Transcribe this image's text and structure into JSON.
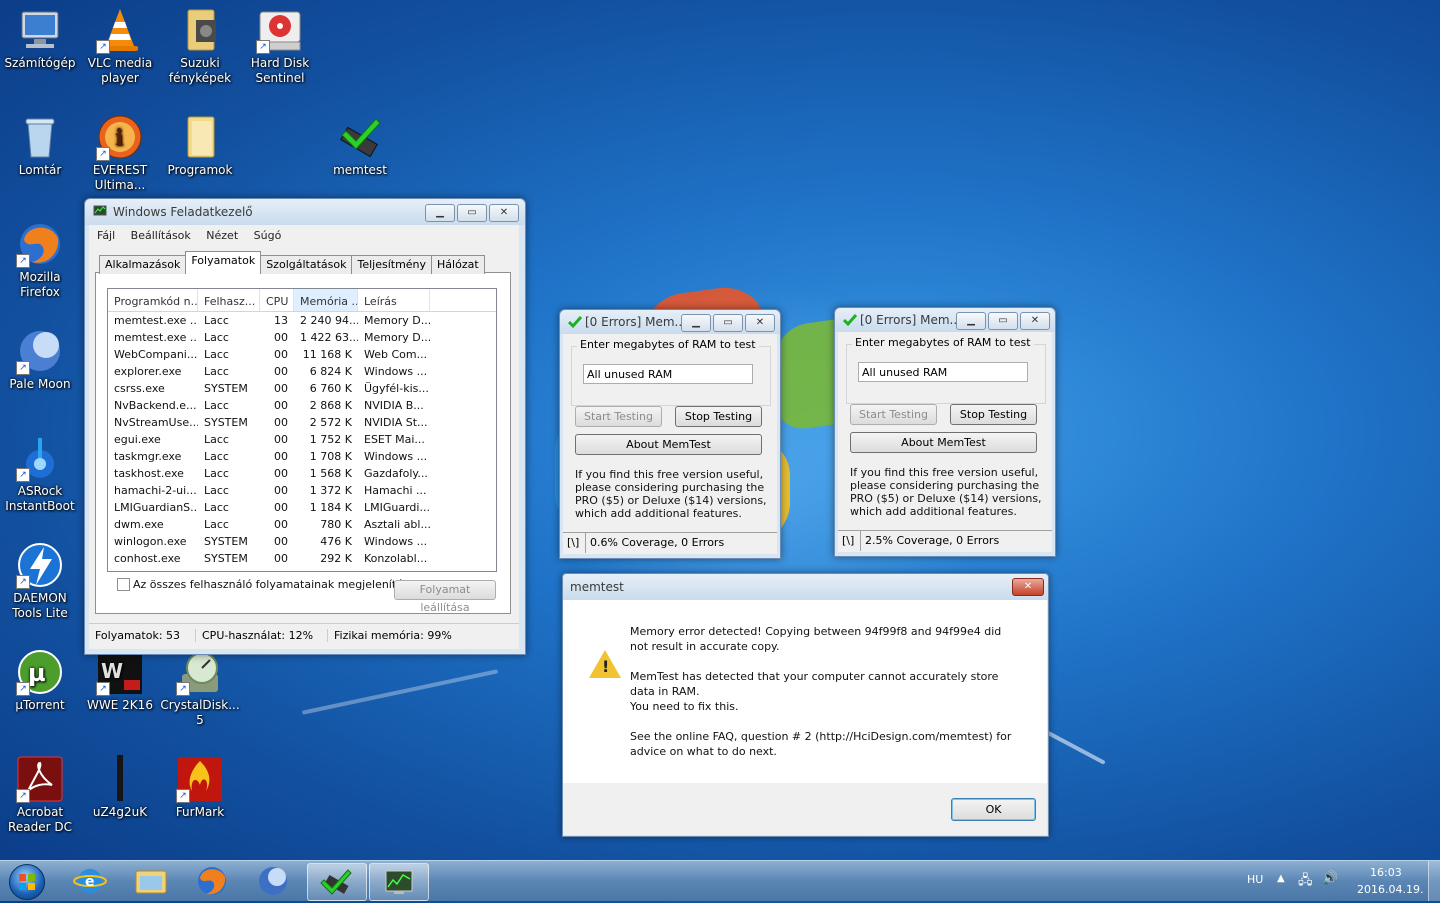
{
  "desktop": {
    "icons": [
      {
        "label": "Számítógép"
      },
      {
        "label": "VLC media player"
      },
      {
        "label": "Suzuki fényképek"
      },
      {
        "label": "Hard Disk Sentinel"
      },
      {
        "label": "Lomtár"
      },
      {
        "label": "EVEREST Ultima..."
      },
      {
        "label": "Programok"
      },
      {
        "label": "memtest"
      },
      {
        "label": "Mozilla Firefox"
      },
      {
        "label": "Pale Moon"
      },
      {
        "label": "ASRock InstantBoot"
      },
      {
        "label": "DAEMON Tools Lite"
      },
      {
        "label": "µTorrent"
      },
      {
        "label": "WWE 2K16"
      },
      {
        "label": "CrystalDisk... 5"
      },
      {
        "label": "Acrobat Reader DC"
      },
      {
        "label": "uZ4g2uK"
      },
      {
        "label": "FurMark"
      }
    ]
  },
  "taskmgr": {
    "title": "Windows Feladatkezelő",
    "menu": [
      "Fájl",
      "Beállítások",
      "Nézet",
      "Súgó"
    ],
    "tabs": [
      "Alkalmazások",
      "Folyamatok",
      "Szolgáltatások",
      "Teljesítmény",
      "Hálózat"
    ],
    "columns": [
      "Programkód n...",
      "Felhasz...",
      "CPU",
      "Memória ...",
      "Leírás"
    ],
    "rows": [
      [
        "memtest.exe ...",
        "Lacc",
        "13",
        "2 240 94...",
        "Memory D..."
      ],
      [
        "memtest.exe ...",
        "Lacc",
        "00",
        "1 422 63...",
        "Memory D..."
      ],
      [
        "WebCompani...",
        "Lacc",
        "00",
        "11 168 K",
        "Web Com..."
      ],
      [
        "explorer.exe",
        "Lacc",
        "00",
        "6 824 K",
        "Windows ..."
      ],
      [
        "csrss.exe",
        "SYSTEM",
        "00",
        "6 760 K",
        "Ügyfél-kis..."
      ],
      [
        "NvBackend.e...",
        "Lacc",
        "00",
        "2 868 K",
        "NVIDIA B..."
      ],
      [
        "NvStreamUse...",
        "SYSTEM",
        "00",
        "2 572 K",
        "NVIDIA St..."
      ],
      [
        "egui.exe",
        "Lacc",
        "00",
        "1 752 K",
        "ESET Mai..."
      ],
      [
        "taskmgr.exe",
        "Lacc",
        "00",
        "1 708 K",
        "Windows ..."
      ],
      [
        "taskhost.exe",
        "Lacc",
        "00",
        "1 568 K",
        "Gazdafoly..."
      ],
      [
        "hamachi-2-ui....",
        "Lacc",
        "00",
        "1 372 K",
        "Hamachi ..."
      ],
      [
        "LMIGuardianS...",
        "Lacc",
        "00",
        "1 184 K",
        "LMIGuardi..."
      ],
      [
        "dwm.exe",
        "Lacc",
        "00",
        "780 K",
        "Asztali abl..."
      ],
      [
        "winlogon.exe",
        "SYSTEM",
        "00",
        "476 K",
        "Windows ..."
      ],
      [
        "conhost.exe",
        "SYSTEM",
        "00",
        "292 K",
        "Konzolabl..."
      ]
    ],
    "show_all_label": "Az összes felhasználó folyamatainak megjelenítése",
    "end_process": "Folyamat leállítása",
    "status": {
      "processes": "Folyamatok: 53",
      "cpu": "CPU-használat: 12%",
      "memory": "Fizikai memória: 99%"
    }
  },
  "memtest1": {
    "title": "[0 Errors] Mem...",
    "group_label": "Enter megabytes of RAM to test",
    "input_value": "All unused RAM",
    "start": "Start Testing",
    "stop": "Stop Testing",
    "about": "About MemTest",
    "info": "If you find this free version useful, please considering purchasing the PRO ($5) or Deluxe ($14) versions, which add additional features.",
    "spinner": "[\\]",
    "status": "0.6% Coverage, 0 Errors"
  },
  "memtest2": {
    "title": "[0 Errors] Mem...",
    "group_label": "Enter megabytes of RAM to test",
    "input_value": "All unused RAM",
    "start": "Start Testing",
    "stop": "Stop Testing",
    "about": "About MemTest",
    "info": "If you find this free version useful, please considering purchasing the PRO ($5) or Deluxe ($14) versions, which add additional features.",
    "spinner": "[\\]",
    "status": "2.5% Coverage, 0 Errors"
  },
  "dialog": {
    "title": "memtest",
    "msg1": "Memory error detected! Copying between 94f99f8 and 94f99e4 did not result in accurate copy.",
    "msg2a": "MemTest has detected that your computer cannot accurately store data in RAM.",
    "msg2b": "You need to fix this.",
    "msg3": "See the online FAQ, question # 2 (http://HciDesign.com/memtest) for advice on what to do next.",
    "ok": "OK"
  },
  "taskbar": {
    "lang": "HU",
    "time": "16:03",
    "date": "2016.04.19."
  }
}
